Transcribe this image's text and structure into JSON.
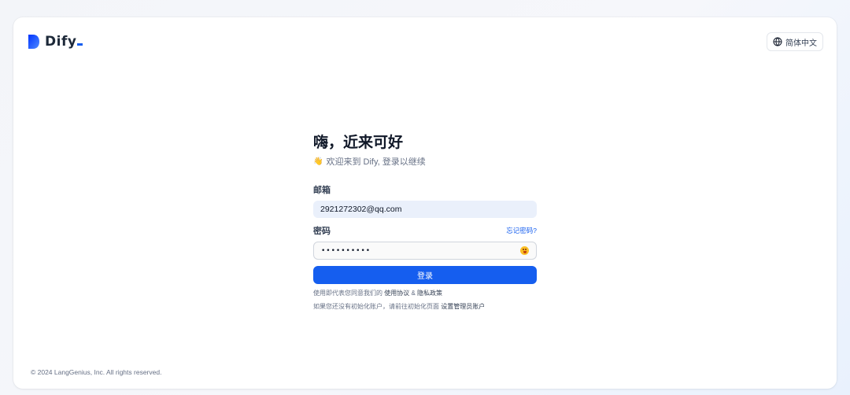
{
  "brand": {
    "name": "Dify",
    "accent": "#155eef",
    "logo_icon": "dify-logo-icon"
  },
  "header": {
    "language_label": "简体中文",
    "language_icon": "globe-icon"
  },
  "login": {
    "title": "嗨，近来可好",
    "subtitle_emoji": "👋",
    "subtitle": "欢迎来到 Dify, 登录以继续",
    "email_label": "邮箱",
    "email_value": "2921272302@qq.com",
    "password_label": "密码",
    "forgot_password": "忘记密码?",
    "password_value": "••••••••••",
    "show_password_icon": "emoji-eye-toggle-icon",
    "submit_label": "登录",
    "terms_prefix": "使用即代表您同意我们的",
    "terms_link": "使用协议",
    "terms_and": "&",
    "privacy_link": "隐私政策",
    "init_text": "如果您还没有初始化账户，请前往初始化页面",
    "init_link": "设置管理员账户"
  },
  "footer": {
    "copyright": "© 2024 LangGenius, Inc. All rights reserved."
  }
}
